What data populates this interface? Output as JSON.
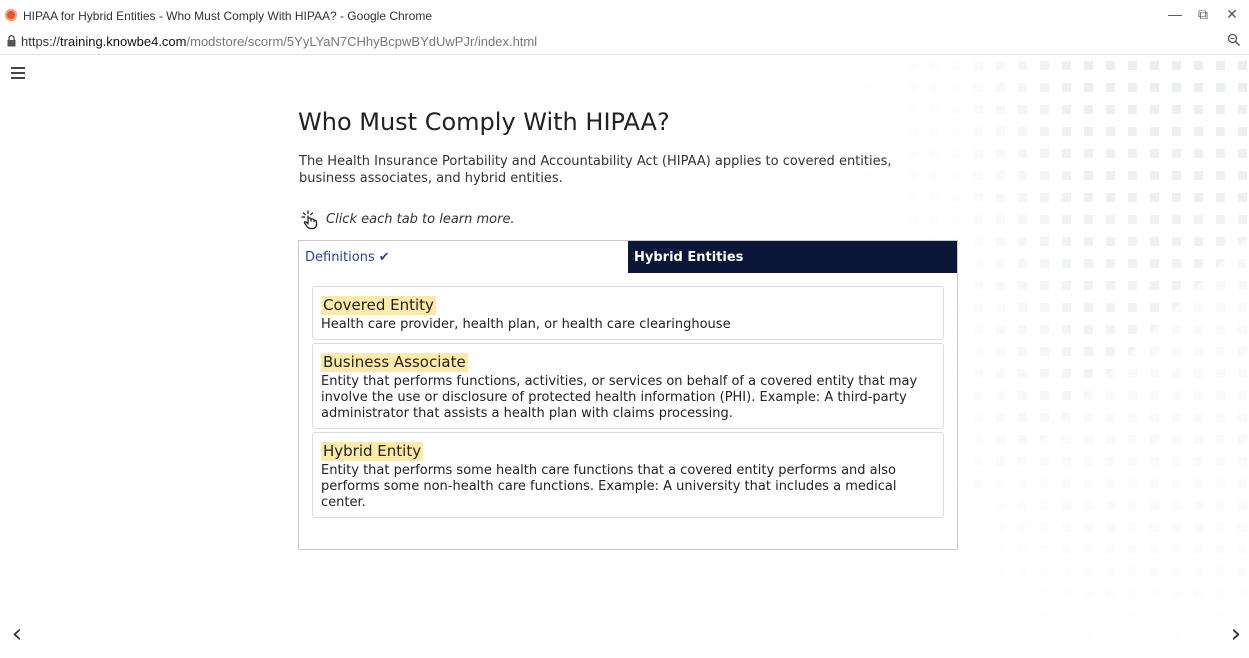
{
  "browser": {
    "window_title": "HIPAA for Hybrid Entities - Who Must Comply With HIPAA? - Google Chrome",
    "url_scheme": "https://",
    "url_host": "training.knowbe4.com",
    "url_path": "/modstore/scorm/5YyLYaN7CHhyBcpwBYdUwPJr/index.html",
    "controls": {
      "minimize": "—",
      "restore": "⧉",
      "close": "✕"
    }
  },
  "page": {
    "title": "Who Must Comply With HIPAA?",
    "intro": "The Health Insurance Portability and Accountability Act (HIPAA) applies to covered entities, business associates, and hybrid entities.",
    "instruction": "Click each tab to learn more."
  },
  "tabs": [
    {
      "label": "Definitions",
      "active": true,
      "visited": true,
      "check": "✔"
    },
    {
      "label": "Hybrid Entities",
      "active": false
    }
  ],
  "definitions": [
    {
      "term": "Covered Entity",
      "text": "Health care provider, health plan, or health care clearinghouse"
    },
    {
      "term": "Business Associate",
      "text": "Entity that performs functions, activities, or services on behalf of a covered entity that may involve the use or disclosure of protected health information (PHI). Example: A third-party administrator that assists a health plan with claims processing."
    },
    {
      "term": "Hybrid Entity",
      "text": "Entity that performs some health care functions that a covered entity performs and also performs some non-health care functions. Example: A university that includes a medical center."
    }
  ],
  "navigation": {
    "prev": "‹",
    "next": "›"
  },
  "colors": {
    "tab_inactive_bg": "#0b1638",
    "tab_active_text": "#2f3e9e",
    "term_highlight": "#fde9a8"
  },
  "icons": [
    "favicon-icon",
    "lock-icon",
    "zoom-icon",
    "menu-icon",
    "tap-icon",
    "check-icon",
    "chevron-left-icon",
    "chevron-right-icon"
  ]
}
